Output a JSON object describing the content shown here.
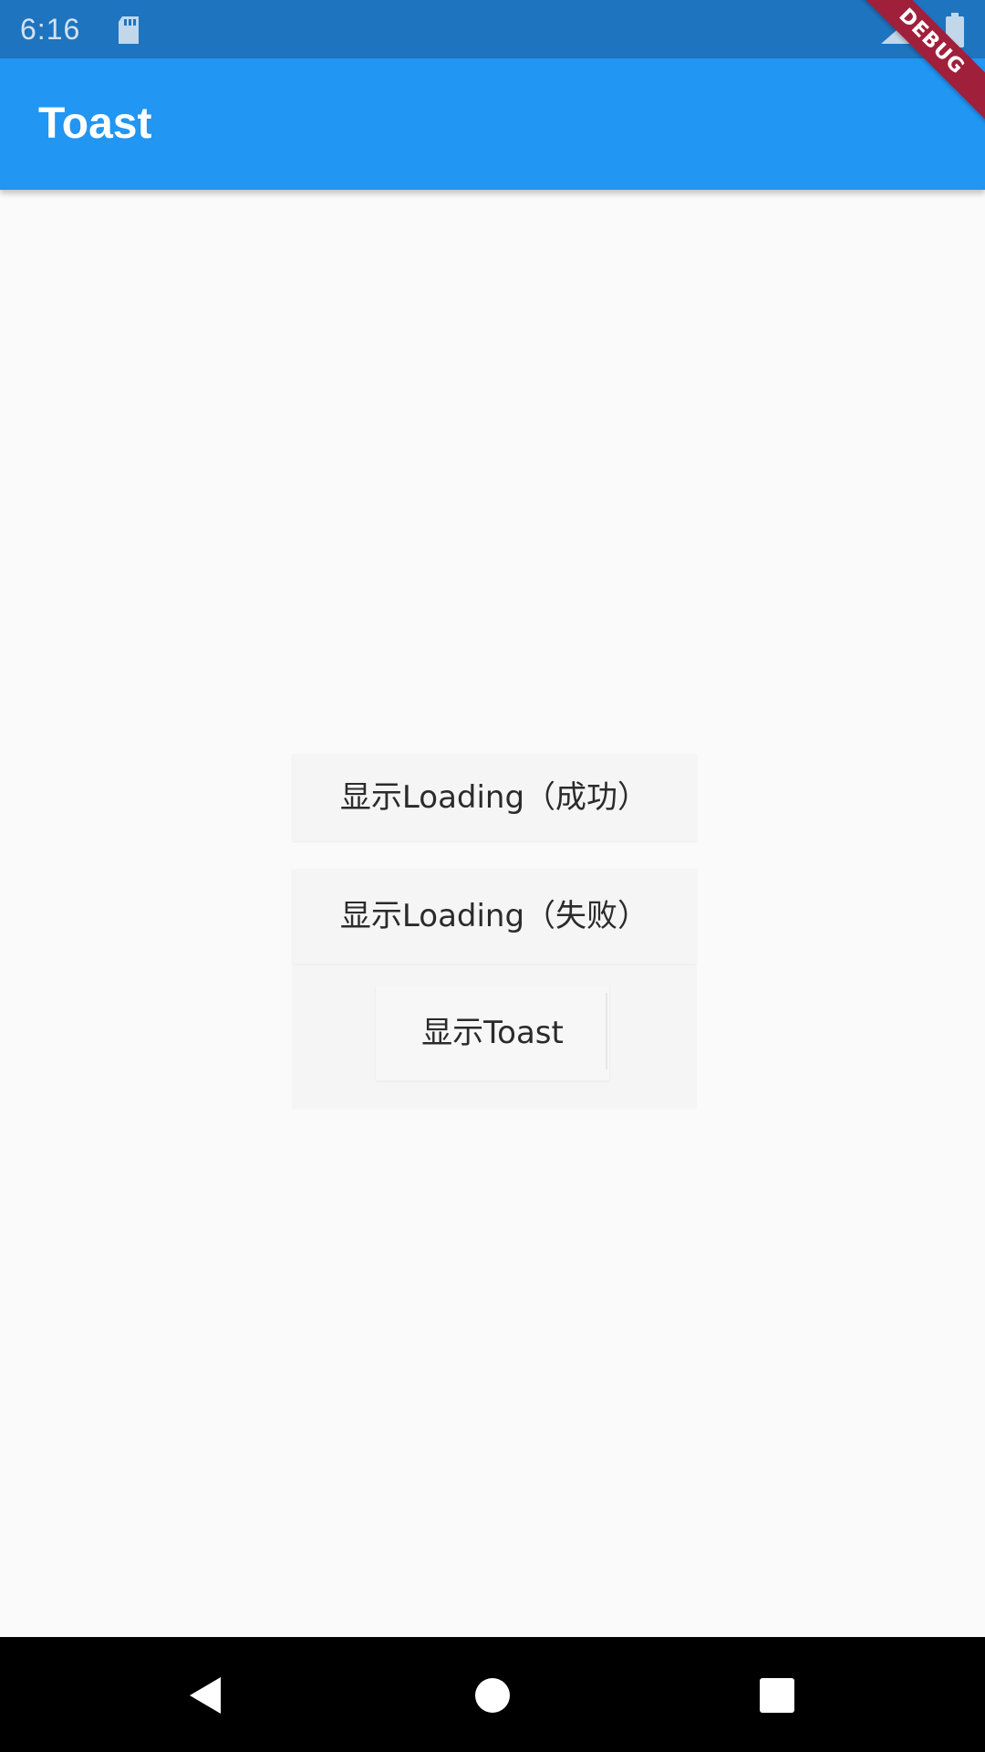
{
  "status_bar": {
    "time": "6:16",
    "icons": [
      "sd-card-icon",
      "signal-icon",
      "battery-icon"
    ]
  },
  "app_bar": {
    "title": "Toast",
    "color": "#2196f3"
  },
  "debug_banner": {
    "label": "DEBUG",
    "color": "#a01f3b"
  },
  "buttons": [
    {
      "label": "显示Loading（成功）"
    },
    {
      "label": "显示Loading（失败）"
    },
    {
      "label": "显示Toast"
    }
  ],
  "nav_bar": {
    "icons": [
      "back-icon",
      "home-icon",
      "recents-icon"
    ]
  }
}
